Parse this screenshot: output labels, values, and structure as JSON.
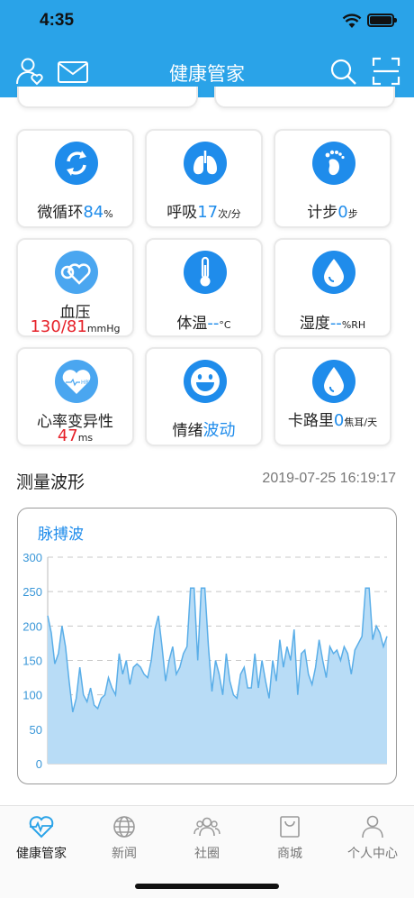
{
  "status": {
    "time": "4:35"
  },
  "header": {
    "title": "健康管家"
  },
  "cards": [
    {
      "label": "微循环",
      "value": "84",
      "unit": "%",
      "icon": "recycle-icon"
    },
    {
      "label": "呼吸",
      "value": "17",
      "unit": "次/分",
      "icon": "lungs-icon"
    },
    {
      "label": "计步",
      "value": "0",
      "unit": "步",
      "icon": "footprint-icon"
    },
    {
      "label": "血压",
      "value": "130/81",
      "unit": "mmHg",
      "icon": "blood-pressure-icon"
    },
    {
      "label": "体温",
      "value": "--",
      "unit": "°C",
      "icon": "thermometer-icon"
    },
    {
      "label": "湿度",
      "value": "--",
      "unit": "%RH",
      "icon": "water-drop-icon"
    },
    {
      "label": "心率变异性",
      "value": "47",
      "unit": "ms",
      "icon": "heart-hrv-icon",
      "icon_text": "HRV"
    },
    {
      "label": "情绪",
      "value": "波动",
      "unit": "",
      "icon": "smiley-icon"
    },
    {
      "label": "卡路里",
      "value": "0",
      "unit": "焦耳/天",
      "icon": "flame-icon"
    }
  ],
  "measurement": {
    "title": "测量波形",
    "timestamp": "2019-07-25 16:19:17"
  },
  "chart_data": {
    "type": "area",
    "title": "脉搏波",
    "ylim": [
      0,
      300
    ],
    "yticks": [
      0,
      50,
      100,
      150,
      200,
      250,
      300
    ],
    "grid": true,
    "x": [
      0,
      1,
      2,
      3,
      4,
      5,
      6,
      7,
      8,
      9,
      10,
      11,
      12,
      13,
      14,
      15,
      16,
      17,
      18,
      19,
      20,
      21,
      22,
      23,
      24,
      25,
      26,
      27,
      28,
      29,
      30,
      31,
      32,
      33,
      34,
      35,
      36,
      37,
      38,
      39,
      40,
      41,
      42,
      43,
      44,
      45,
      46,
      47,
      48,
      49,
      50,
      51,
      52,
      53,
      54,
      55,
      56,
      57,
      58,
      59,
      60,
      61,
      62,
      63,
      64,
      65,
      66,
      67,
      68,
      69,
      70,
      71,
      72,
      73,
      74,
      75,
      76,
      77,
      78,
      79,
      80,
      81,
      82,
      83,
      84,
      85,
      86,
      87,
      88,
      89,
      90,
      91,
      92,
      93,
      94,
      95
    ],
    "values": [
      215,
      190,
      145,
      160,
      200,
      170,
      120,
      75,
      95,
      140,
      100,
      90,
      110,
      85,
      80,
      95,
      100,
      125,
      110,
      100,
      160,
      130,
      150,
      115,
      140,
      145,
      140,
      130,
      125,
      150,
      195,
      215,
      170,
      120,
      150,
      170,
      130,
      140,
      160,
      170,
      255,
      255,
      150,
      255,
      255,
      170,
      105,
      150,
      130,
      100,
      160,
      120,
      100,
      95,
      130,
      140,
      110,
      110,
      160,
      110,
      150,
      120,
      95,
      150,
      120,
      180,
      140,
      170,
      150,
      195,
      100,
      160,
      165,
      130,
      115,
      140,
      180,
      150,
      125,
      170,
      160,
      165,
      150,
      170,
      160,
      130,
      165,
      175,
      185,
      255,
      255,
      180,
      200,
      190,
      170,
      185
    ],
    "line_color": "#5aaee8",
    "fill_color": "#b8dcf6"
  },
  "tabs": [
    {
      "label": "健康管家",
      "icon": "heart-pulse-icon",
      "active": true
    },
    {
      "label": "新闻",
      "icon": "globe-icon",
      "active": false
    },
    {
      "label": "社圈",
      "icon": "group-icon",
      "active": false
    },
    {
      "label": "商城",
      "icon": "shopping-bag-icon",
      "active": false
    },
    {
      "label": "个人中心",
      "icon": "person-icon",
      "active": false
    }
  ],
  "colors": {
    "accent": "#2aa3e8",
    "icon_blue": "#1f8ceb",
    "alert_red": "#e62129"
  }
}
